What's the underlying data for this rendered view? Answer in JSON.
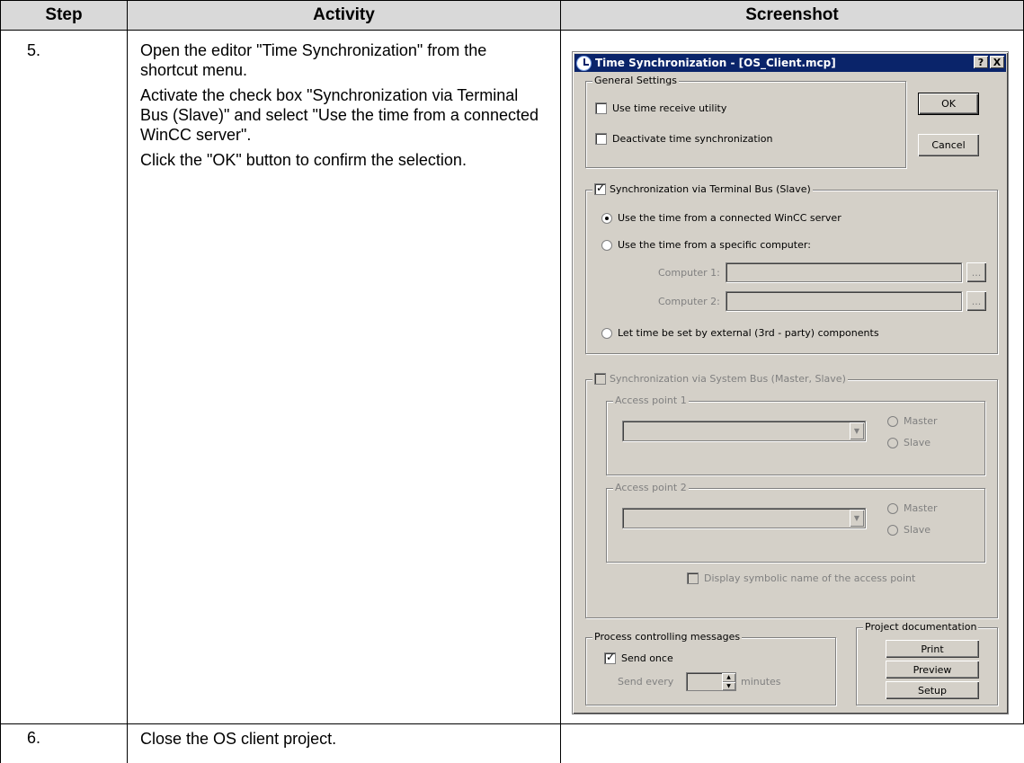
{
  "table": {
    "headers": {
      "step": "Step",
      "activity": "Activity",
      "screenshot": "Screenshot"
    },
    "rows": [
      {
        "step": "5.",
        "paragraphs": [
          "Open the editor \"Time Synchronization\" from the shortcut menu.",
          "Activate the check box \"Synchronization via Terminal Bus (Slave)\" and select \"Use the time from a connected WinCC server\".",
          "Click the \"OK\" button to confirm the selection."
        ]
      },
      {
        "step": "6.",
        "paragraphs": [
          "Close the OS client project."
        ]
      }
    ]
  },
  "dialog": {
    "title": "Time Synchronization - [OS_Client.mcp]",
    "help_btn": "?",
    "close_btn": "X",
    "general": {
      "label": "General Settings",
      "use_time_receive": {
        "label": "Use time receive utility",
        "checked": false
      },
      "deactivate": {
        "label": "Deactivate time synchronization",
        "checked": false
      }
    },
    "ok_label": "OK",
    "cancel_label": "Cancel",
    "terminal_bus": {
      "label": "Synchronization via Terminal Bus (Slave)",
      "checked": true,
      "opt_winccserver": "Use the time from a connected WinCC server",
      "opt_specific": "Use the time from a specific computer:",
      "computer1_label": "Computer 1:",
      "computer2_label": "Computer 2:",
      "browse": "...",
      "opt_external": "Let time be set by external (3rd - party) components",
      "selected": "winccserver"
    },
    "system_bus": {
      "label": "Synchronization via System Bus (Master, Slave)",
      "checked": false,
      "ap1_label": "Access point 1",
      "ap2_label": "Access point 2",
      "master": "Master",
      "slave": "Slave",
      "display_symbolic": "Display symbolic name of the access point"
    },
    "process": {
      "label": "Process controlling messages",
      "send_once": "Send once",
      "send_once_checked": true,
      "send_every": "Send every",
      "minutes": "minutes"
    },
    "project_doc": {
      "label": "Project documentation",
      "print": "Print",
      "preview": "Preview",
      "setup": "Setup"
    }
  }
}
